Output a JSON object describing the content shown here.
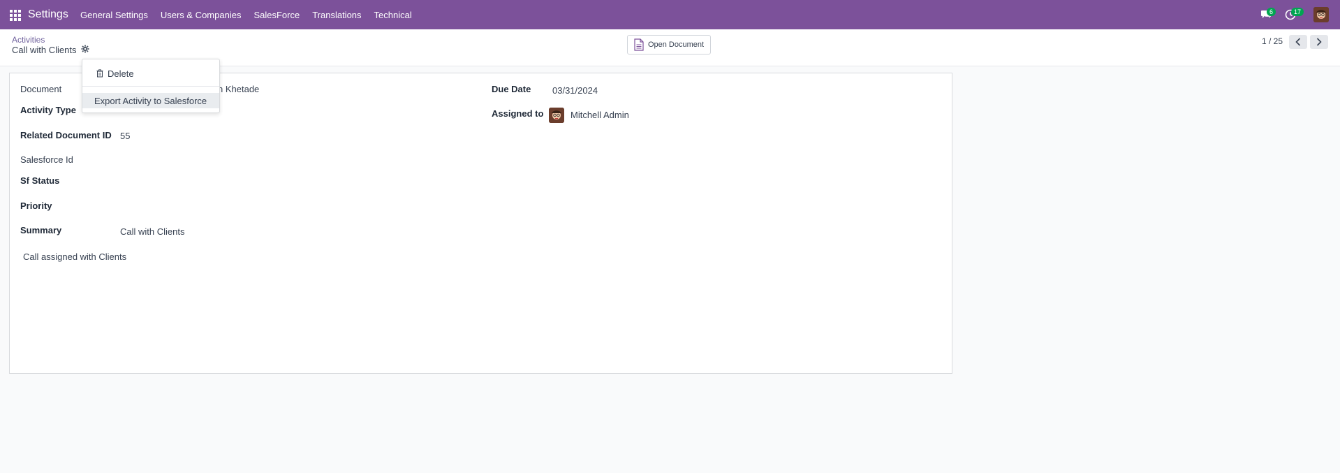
{
  "navbar": {
    "brand": "Settings",
    "menu": [
      "General Settings",
      "Users & Companies",
      "SalesForce",
      "Translations",
      "Technical"
    ],
    "chat_count": "6",
    "activity_count": "17",
    "bg_color": "#7c519a"
  },
  "control_panel": {
    "breadcrumb": "Activities",
    "title": "Call with Clients",
    "open_document_label": "Open Document",
    "pager": "1 / 25"
  },
  "dropdown": {
    "delete_label": "Delete",
    "export_label": "Export Activity to Salesforce"
  },
  "form": {
    "document_label": "Document",
    "document_value": "n Khetade",
    "activity_type_label": "Activity Type",
    "related_document_id_label": "Related Document ID",
    "related_document_id_value": "55",
    "salesforce_id_label": "Salesforce Id",
    "sf_status_label": "Sf Status",
    "priority_label": "Priority",
    "summary_label": "Summary",
    "summary_value": "Call with Clients",
    "note": "Call assigned with Clients",
    "due_date_label": "Due Date",
    "due_date_value": "03/31/2024",
    "assigned_to_label": "Assigned to",
    "assigned_to_value": "Mitchell Admin"
  }
}
